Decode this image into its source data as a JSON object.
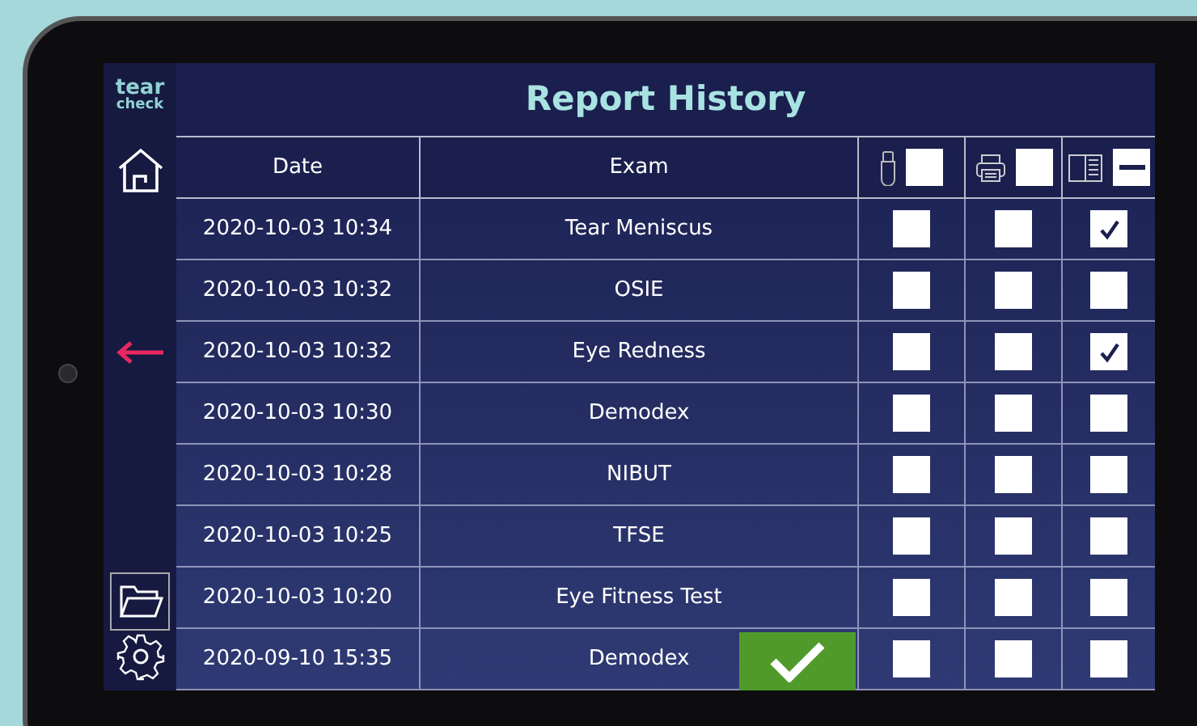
{
  "logo": {
    "line1": "tear",
    "line2": "check"
  },
  "title": "Report History",
  "columns": [
    {
      "kind": "text",
      "label": "Date"
    },
    {
      "kind": "text",
      "label": "Exam"
    },
    {
      "kind": "usb",
      "indeterminate": false
    },
    {
      "kind": "print",
      "indeterminate": false
    },
    {
      "kind": "report",
      "indeterminate": true
    }
  ],
  "rows": [
    {
      "date": "2020-10-03 10:34",
      "exam": "Tear Meniscus",
      "usb": false,
      "print": false,
      "report": true
    },
    {
      "date": "2020-10-03 10:32",
      "exam": "OSIE",
      "usb": false,
      "print": false,
      "report": false
    },
    {
      "date": "2020-10-03 10:32",
      "exam": "Eye Redness",
      "usb": false,
      "print": false,
      "report": true
    },
    {
      "date": "2020-10-03 10:30",
      "exam": "Demodex",
      "usb": false,
      "print": false,
      "report": false
    },
    {
      "date": "2020-10-03 10:28",
      "exam": "NIBUT",
      "usb": false,
      "print": false,
      "report": false
    },
    {
      "date": "2020-10-03 10:25",
      "exam": "TFSE",
      "usb": false,
      "print": false,
      "report": false
    },
    {
      "date": "2020-10-03 10:20",
      "exam": "Eye Fitness Test",
      "usb": false,
      "print": false,
      "report": false
    },
    {
      "date": "2020-09-10 15:35",
      "exam": "Demodex",
      "usb": false,
      "print": false,
      "report": false
    }
  ]
}
